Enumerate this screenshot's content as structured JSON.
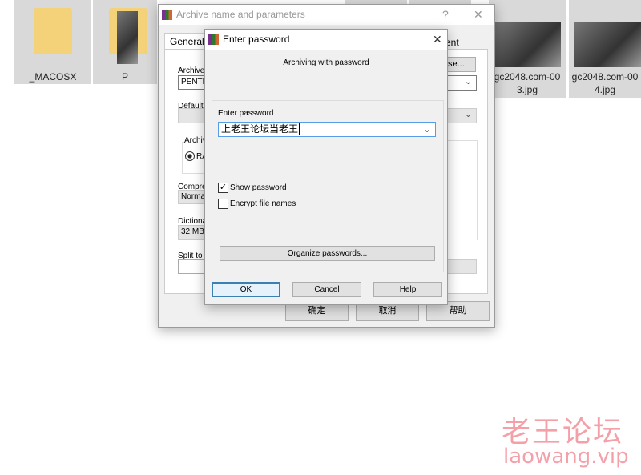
{
  "explorer": {
    "items": [
      {
        "label": "_MACOSX",
        "type": "folder"
      },
      {
        "label": "P",
        "type": "folder"
      },
      {
        "label": "gc2048.com-00\n3.jpg",
        "line1": "gc2048.com-00",
        "line2": "3.jpg",
        "type": "image"
      },
      {
        "label": "gc2048.com-00\n4.jpg",
        "line1": "gc2048.com-00",
        "line2": "4.jpg",
        "type": "image"
      }
    ]
  },
  "archive_dialog": {
    "title": "Archive name and parameters",
    "help_glyph": "?",
    "tabs": [
      "General",
      "ent"
    ],
    "labels": {
      "archive": "Archive",
      "default": "Default",
      "archive_format": "Archiv",
      "radio": "RA",
      "compression": "Compre",
      "dictionary": "Dictiona",
      "split": "Split to"
    },
    "archive_name": "PENTH",
    "compression_value": "Normal",
    "dictionary_value": "32 MB",
    "browse_label": "se...",
    "buttons": {
      "ok": "确定",
      "cancel": "取消",
      "help": "帮助"
    }
  },
  "password_dialog": {
    "title": "Enter password",
    "heading": "Archiving with password",
    "password_label": "Enter password",
    "password_value": "上老王论坛当老王",
    "show_password": {
      "label": "Show password",
      "checked": true
    },
    "encrypt_names": {
      "label": "Encrypt file names",
      "checked": false
    },
    "organize_label": "Organize passwords...",
    "buttons": {
      "ok": "OK",
      "cancel": "Cancel",
      "help": "Help"
    }
  },
  "watermark": {
    "cn": "老王论坛",
    "url": "laowang.vip",
    "color": "#f4a0a8"
  }
}
